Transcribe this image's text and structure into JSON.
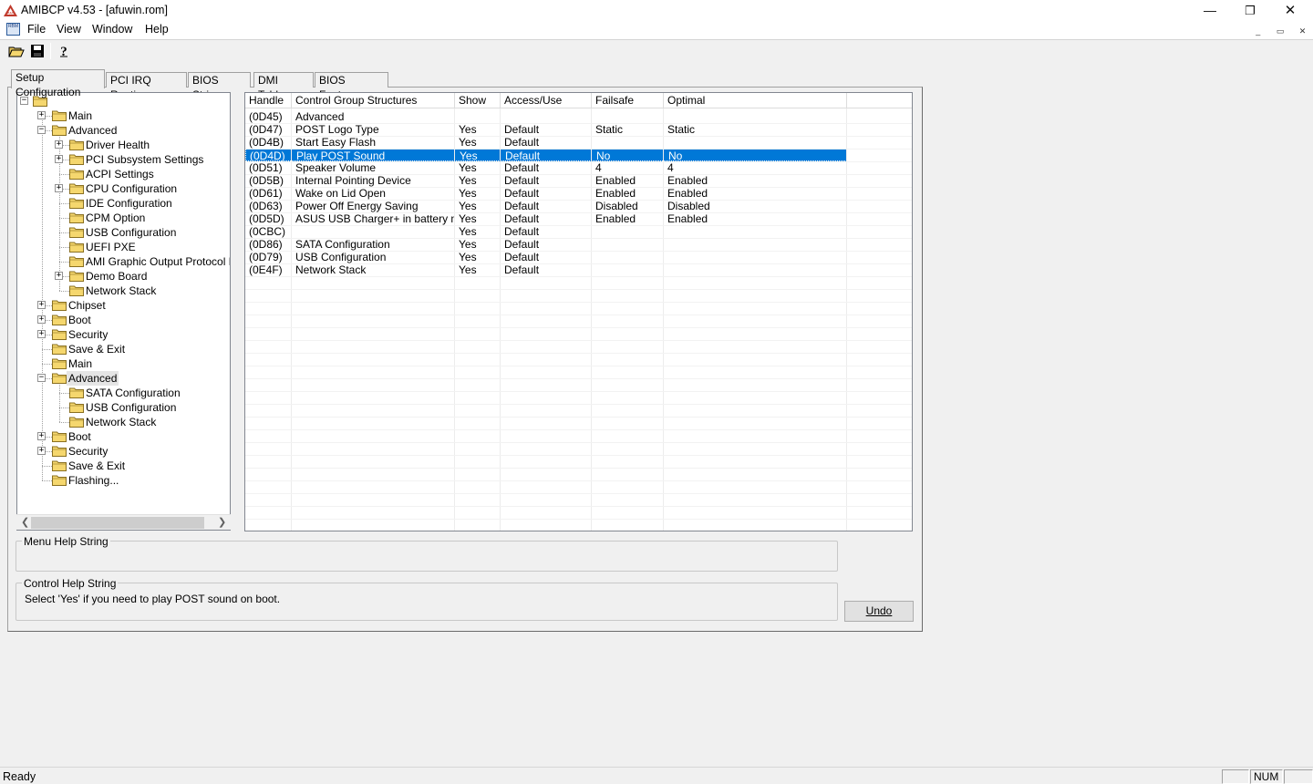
{
  "window": {
    "title": "AMIBCP v4.53 - [afuwin.rom]",
    "controls": {
      "minimize": "—",
      "maximize": "❐",
      "close": "✕"
    }
  },
  "menu": {
    "items": [
      "File",
      "View",
      "Window",
      "Help"
    ],
    "mdi": {
      "minimize": "_",
      "restore": "▭",
      "close": "✕"
    }
  },
  "toolbar": {
    "buttons": [
      "open-icon",
      "save-icon",
      "help-icon"
    ]
  },
  "tabs": [
    "Setup Configuration",
    "PCI IRQ Routing",
    "BIOS Strings",
    "DMI Tables",
    "BIOS Features"
  ],
  "tree": [
    {
      "label": "",
      "depth": 0,
      "exp": "−"
    },
    {
      "label": "Main",
      "depth": 1,
      "exp": "+"
    },
    {
      "label": "Advanced",
      "depth": 1,
      "exp": "−"
    },
    {
      "label": "Driver Health",
      "depth": 2,
      "exp": "+"
    },
    {
      "label": "PCI Subsystem Settings",
      "depth": 2,
      "exp": "+"
    },
    {
      "label": "ACPI Settings",
      "depth": 2,
      "exp": ""
    },
    {
      "label": "CPU Configuration",
      "depth": 2,
      "exp": "+"
    },
    {
      "label": "IDE Configuration",
      "depth": 2,
      "exp": ""
    },
    {
      "label": "CPM Option",
      "depth": 2,
      "exp": ""
    },
    {
      "label": "USB Configuration",
      "depth": 2,
      "exp": ""
    },
    {
      "label": "UEFI PXE",
      "depth": 2,
      "exp": ""
    },
    {
      "label": "AMI Graphic Output Protocol Poli",
      "depth": 2,
      "exp": ""
    },
    {
      "label": "Demo Board",
      "depth": 2,
      "exp": "+"
    },
    {
      "label": "Network Stack",
      "depth": 2,
      "exp": ""
    },
    {
      "label": "Chipset",
      "depth": 1,
      "exp": "+"
    },
    {
      "label": "Boot",
      "depth": 1,
      "exp": "+"
    },
    {
      "label": "Security",
      "depth": 1,
      "exp": "+"
    },
    {
      "label": "Save & Exit",
      "depth": 1,
      "exp": ""
    },
    {
      "label": "Main",
      "depth": 1,
      "exp": ""
    },
    {
      "label": "Advanced",
      "depth": 1,
      "exp": "−",
      "selected": true
    },
    {
      "label": "SATA Configuration",
      "depth": 2,
      "exp": ""
    },
    {
      "label": "USB Configuration",
      "depth": 2,
      "exp": ""
    },
    {
      "label": "Network Stack",
      "depth": 2,
      "exp": ""
    },
    {
      "label": "Boot",
      "depth": 1,
      "exp": "+"
    },
    {
      "label": "Security",
      "depth": 1,
      "exp": "+"
    },
    {
      "label": "Save & Exit",
      "depth": 1,
      "exp": ""
    },
    {
      "label": "Flashing...",
      "depth": 1,
      "exp": ""
    }
  ],
  "grid": {
    "columns": [
      "Handle",
      "Control Group Structures",
      "Show",
      "Access/Use",
      "Failsafe",
      "Optimal"
    ],
    "selected_index": 3,
    "rows": [
      [
        "(0D45)",
        "Advanced",
        "",
        "",
        "",
        ""
      ],
      [
        "(0D47)",
        "POST Logo Type",
        "Yes",
        "Default",
        "Static",
        "Static"
      ],
      [
        "(0D4B)",
        "Start Easy Flash",
        "Yes",
        "Default",
        "",
        ""
      ],
      [
        "(0D4D)",
        "Play POST Sound",
        "Yes",
        "Default",
        "No",
        "No"
      ],
      [
        "(0D51)",
        "Speaker Volume",
        "Yes",
        "Default",
        "4",
        "4"
      ],
      [
        "(0D5B)",
        "Internal Pointing Device",
        "Yes",
        "Default",
        "Enabled",
        "Enabled"
      ],
      [
        "(0D61)",
        "Wake on Lid Open",
        "Yes",
        "Default",
        "Enabled",
        "Enabled"
      ],
      [
        "(0D63)",
        "Power Off Energy Saving",
        "Yes",
        "Default",
        "Disabled",
        "Disabled"
      ],
      [
        "(0D5D)",
        "ASUS USB Charger+ in battery m...",
        "Yes",
        "Default",
        "Enabled",
        "Enabled"
      ],
      [
        "(0CBC)",
        "",
        "Yes",
        "Default",
        "",
        ""
      ],
      [
        "(0D86)",
        "SATA Configuration",
        "Yes",
        "Default",
        "",
        ""
      ],
      [
        "(0D79)",
        "USB Configuration",
        "Yes",
        "Default",
        "",
        ""
      ],
      [
        "(0E4F)",
        "Network Stack",
        "Yes",
        "Default",
        "",
        ""
      ]
    ]
  },
  "help": {
    "menu_label": "Menu Help String",
    "menu_text": "",
    "control_label": "Control Help String",
    "control_text": "Select 'Yes' if you need to play POST sound on boot."
  },
  "undo_label": "Undo",
  "status": {
    "text": "Ready",
    "pane1": "",
    "pane2": "NUM",
    "pane3": ""
  },
  "colors": {
    "selection": "#0078d7",
    "folder": "#f5d76e",
    "app_icon_red": "#c0392b"
  }
}
